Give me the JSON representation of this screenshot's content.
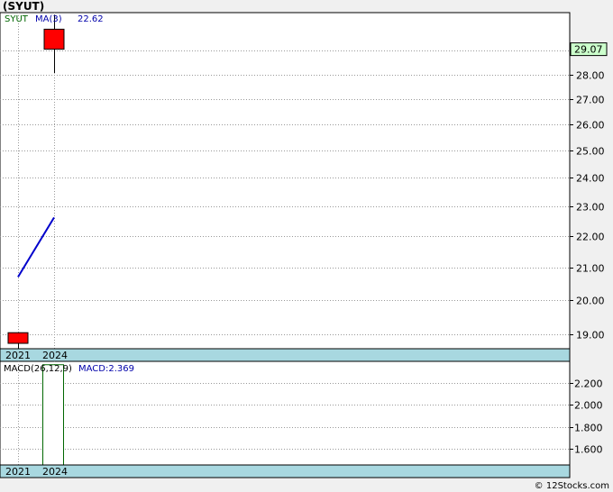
{
  "title": "(SYUT)",
  "footer": "© 12Stocks.com",
  "price_panel": {
    "symbol_label": "SYUT",
    "ma_label": "MA(3)",
    "ma_value": "22.62",
    "last_price_label": "29.07",
    "x_labels": [
      "2021",
      "2024"
    ]
  },
  "macd_panel": {
    "label": "MACD(26,12,9)",
    "value_label": "MACD:2.369",
    "x_labels": [
      "2021",
      "2024"
    ]
  },
  "colors": {
    "down_candle": "#ff0000",
    "ma_line": "#0000cc",
    "macd_bar": "#006600",
    "axis_band": "#a8d8e0",
    "last_price_bg": "#ccffcc",
    "symbol_text": "#006600",
    "ma_text": "#0000aa"
  },
  "chart_data": [
    {
      "type": "candlestick",
      "x": [
        "2021",
        "2024"
      ],
      "yscale": "log",
      "ylim": [
        18.6,
        30.7
      ],
      "yticks": [
        19,
        20,
        21,
        22,
        23,
        24,
        25,
        26,
        27,
        28,
        29
      ],
      "ytick_labels": [
        "19.00",
        "20.00",
        "21.00",
        "22.00",
        "23.00",
        "24.00",
        "25.00",
        "26.00",
        "27.00",
        "28.00",
        "29.00"
      ],
      "candles": [
        {
          "x": "2021",
          "open": 19.05,
          "high": 19.05,
          "low": 18.6,
          "close": 18.75
        },
        {
          "x": "2024",
          "open": 29.95,
          "high": 30.6,
          "low": 28.05,
          "close": 29.07
        }
      ],
      "series": [
        {
          "name": "MA(3)",
          "type": "line",
          "values": [
            20.7,
            22.62
          ]
        }
      ],
      "grid": true
    },
    {
      "type": "bar",
      "x": [
        "2021",
        "2024"
      ],
      "ylim": [
        1.45,
        2.4
      ],
      "yticks": [
        1.6,
        1.8,
        2.0,
        2.2
      ],
      "ytick_labels": [
        "1.600",
        "1.800",
        "2.000",
        "2.200"
      ],
      "series": [
        {
          "name": "MACD(26,12,9)",
          "values": [
            null,
            2.369
          ]
        }
      ],
      "grid": true
    }
  ]
}
